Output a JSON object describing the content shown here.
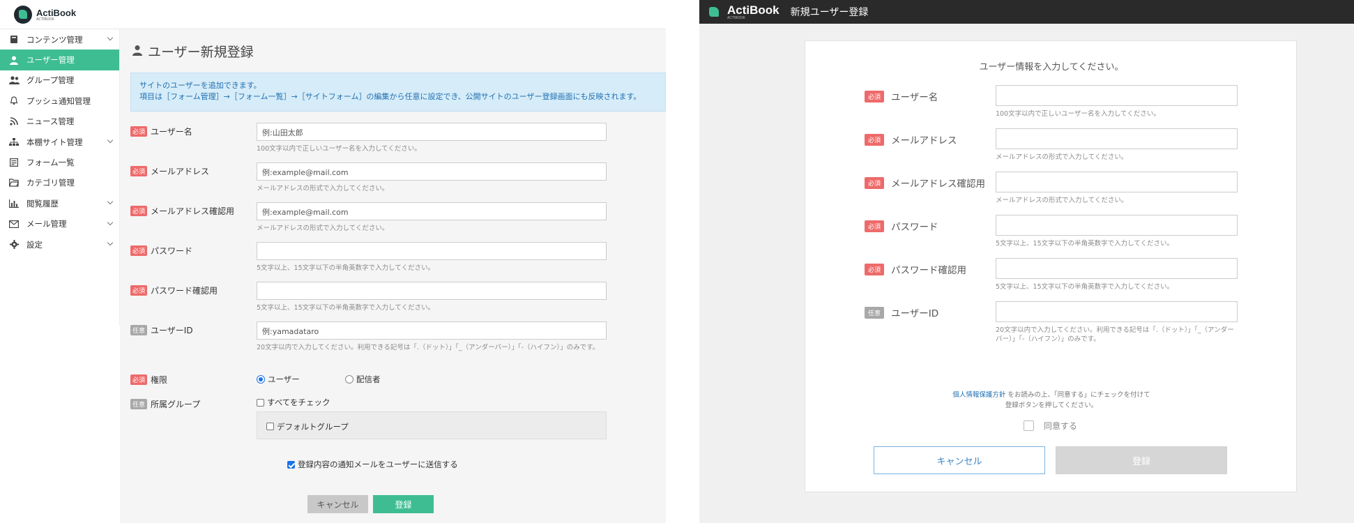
{
  "left": {
    "logo": {
      "name": "ActiBook",
      "sub": "ACTIBOOK"
    },
    "sidebar": {
      "items": [
        {
          "label": "コンテンツ管理",
          "icon": "book-icon",
          "chevron": true,
          "active": false
        },
        {
          "label": "ユーザー管理",
          "icon": "user-icon",
          "chevron": false,
          "active": true
        },
        {
          "label": "グループ管理",
          "icon": "users-icon",
          "chevron": false,
          "active": false
        },
        {
          "label": "プッシュ通知管理",
          "icon": "bell-icon",
          "chevron": false,
          "active": false
        },
        {
          "label": "ニュース管理",
          "icon": "rss-icon",
          "chevron": false,
          "active": false
        },
        {
          "label": "本棚サイト管理",
          "icon": "sitemap-icon",
          "chevron": true,
          "active": false
        },
        {
          "label": "フォーム一覧",
          "icon": "form-icon",
          "chevron": false,
          "active": false
        },
        {
          "label": "カテゴリ管理",
          "icon": "folder-icon",
          "chevron": false,
          "active": false
        },
        {
          "label": "閲覧履歴",
          "icon": "chart-icon",
          "chevron": true,
          "active": false
        },
        {
          "label": "メール管理",
          "icon": "mail-icon",
          "chevron": true,
          "active": false
        },
        {
          "label": "設定",
          "icon": "gear-icon",
          "chevron": true,
          "active": false
        }
      ]
    },
    "page_title": "ユーザー新規登録",
    "info": {
      "line1": "サイトのユーザーを追加できます。",
      "line2": "項目は［フォーム管理］→［フォーム一覧］→［サイトフォーム］の編集から任意に設定でき、公開サイトのユーザー登録画面にも反映されます。"
    },
    "badges": {
      "required": "必須",
      "optional": "任意"
    },
    "fields": {
      "username": {
        "label": "ユーザー名",
        "placeholder": "例:山田太郎",
        "help": "100文字以内で正しいユーザー名を入力してください。"
      },
      "email": {
        "label": "メールアドレス",
        "placeholder": "例:example@mail.com",
        "help": "メールアドレスの形式で入力してください。"
      },
      "email_confirm": {
        "label": "メールアドレス確認用",
        "placeholder": "例:example@mail.com",
        "help": "メールアドレスの形式で入力してください。"
      },
      "password": {
        "label": "パスワード",
        "placeholder": "",
        "help": "5文字以上、15文字以下の半角英数字で入力してください。"
      },
      "password_confirm": {
        "label": "パスワード確認用",
        "placeholder": "",
        "help": "5文字以上、15文字以下の半角英数字で入力してください。"
      },
      "user_id": {
        "label": "ユーザーID",
        "placeholder": "例:yamadataro",
        "help": "20文字以内で入力してください。利用できる記号は「.（ドット）」「_（アンダーバー）」「-（ハイフン）」のみです。"
      }
    },
    "role": {
      "label": "権限",
      "options": [
        "ユーザー",
        "配信者"
      ],
      "selected": "ユーザー"
    },
    "groups": {
      "label": "所属グループ",
      "check_all": "すべてをチェック",
      "items": [
        "デフォルトグループ"
      ]
    },
    "notify": {
      "label": "登録内容の通知メールをユーザーに送信する",
      "checked": true
    },
    "buttons": {
      "cancel": "キャンセル",
      "submit": "登録"
    }
  },
  "right": {
    "logo": {
      "name": "ActiBook",
      "sub": "ACTIBOOK"
    },
    "header_title": "新規ユーザー登録",
    "lead": "ユーザー情報を入力してください。",
    "badges": {
      "required": "必須",
      "optional": "任意"
    },
    "fields": [
      {
        "label": "ユーザー名",
        "required": true,
        "help": "100文字以内で正しいユーザー名を入力してください。"
      },
      {
        "label": "メールアドレス",
        "required": true,
        "help": "メールアドレスの形式で入力してください。"
      },
      {
        "label": "メールアドレス確認用",
        "required": true,
        "help": "メールアドレスの形式で入力してください。"
      },
      {
        "label": "パスワード",
        "required": true,
        "help": "5文字以上、15文字以下の半角英数字で入力してください。"
      },
      {
        "label": "パスワード確認用",
        "required": true,
        "help": "5文字以上、15文字以下の半角英数字で入力してください。"
      },
      {
        "label": "ユーザーID",
        "required": false,
        "help": "20文字以内で入力してください。利用できる記号は「.（ドット）」「_（アンダーバー）」「-（ハイフン）」のみです。"
      }
    ],
    "policy": {
      "link": "個人情報保護方針",
      "line1_rest": "をお読みの上、「同意する」にチェックを付けて",
      "line2": "登録ボタンを押してください。"
    },
    "agree": {
      "label": "同意する",
      "checked": false
    },
    "buttons": {
      "cancel": "キャンセル",
      "submit": "登録"
    }
  }
}
